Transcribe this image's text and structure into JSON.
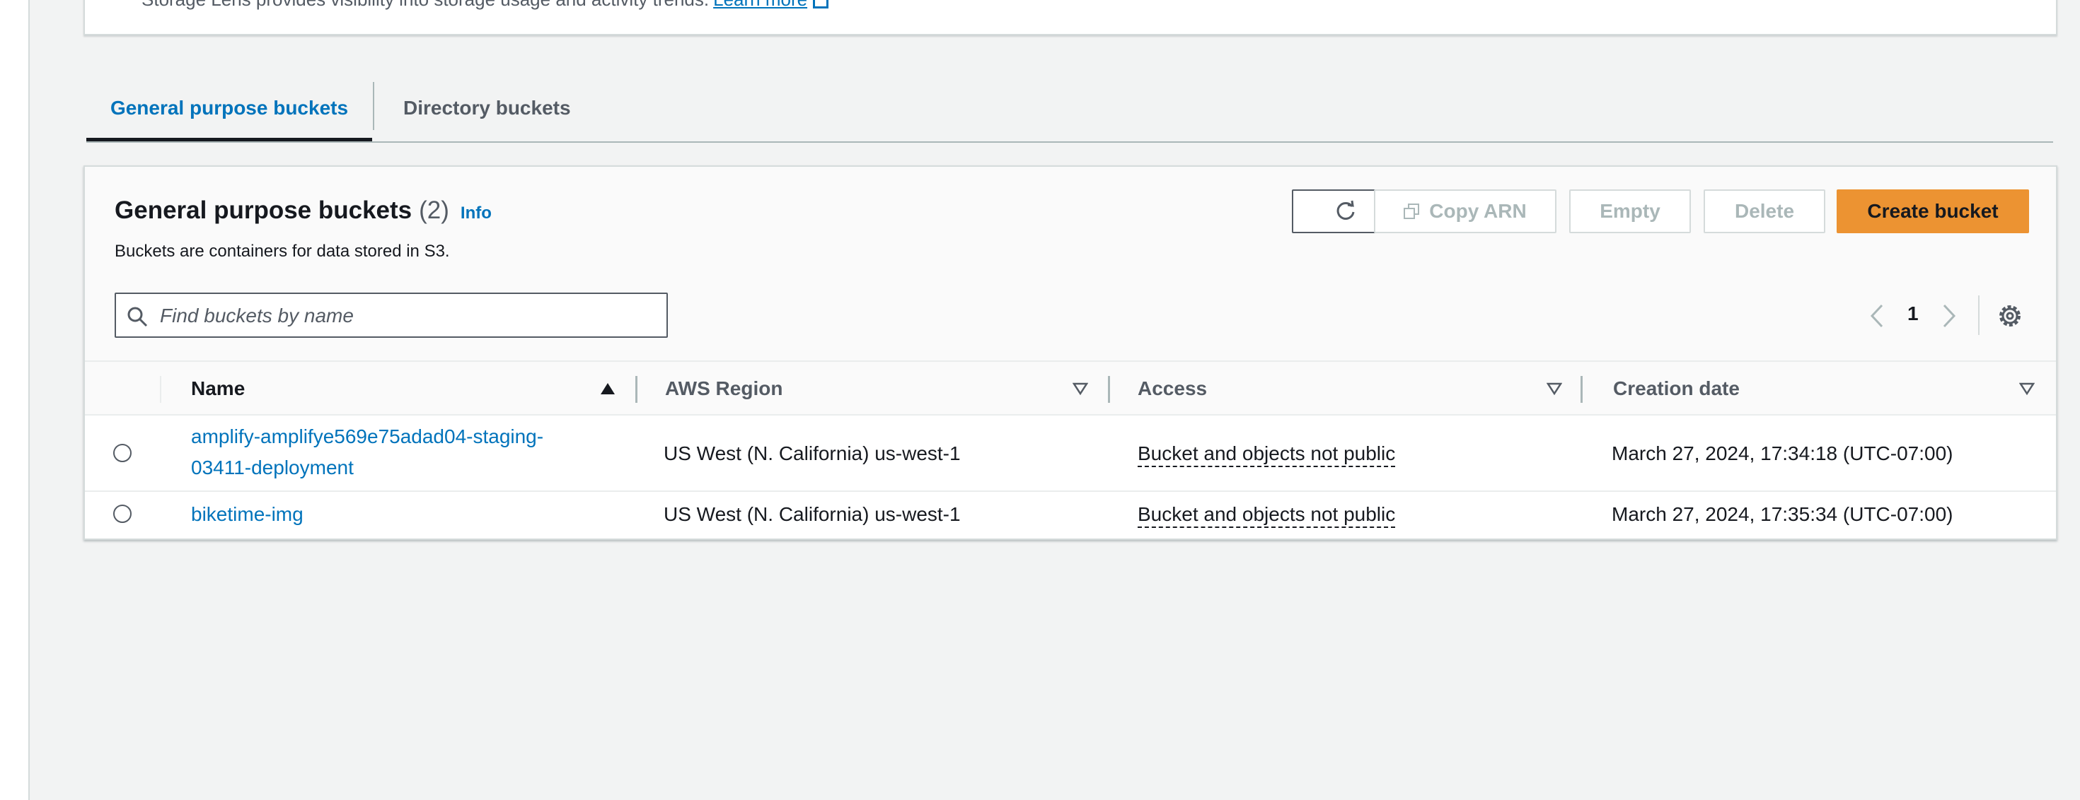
{
  "top_panel": {
    "text": "Storage Lens provides visibility into storage usage and activity trends.",
    "link": "Learn more"
  },
  "tabs": [
    {
      "label": "General purpose buckets",
      "active": true
    },
    {
      "label": "Directory buckets",
      "active": false
    }
  ],
  "container": {
    "title": "General purpose buckets",
    "count": "(2)",
    "info": "Info",
    "description": "Buckets are containers for data stored in S3."
  },
  "actions": {
    "refresh_icon": "refresh-icon",
    "copy_arn": "Copy ARN",
    "empty": "Empty",
    "delete": "Delete",
    "create": "Create bucket"
  },
  "search": {
    "placeholder": "Find buckets by name",
    "value": ""
  },
  "pagination": {
    "current_page": "1"
  },
  "table": {
    "columns": [
      "Name",
      "AWS Region",
      "Access",
      "Creation date"
    ],
    "rows": [
      {
        "name": "amplify-amplifye569e75adad04-staging-03411-deployment",
        "region": "US West (N. California) us-west-1",
        "access": "Bucket and objects not public",
        "created": "March 27, 2024, 17:34:18 (UTC-07:00)"
      },
      {
        "name": "biketime-img",
        "region": "US West (N. California) us-west-1",
        "access": "Bucket and objects not public",
        "created": "March 27, 2024, 17:35:34 (UTC-07:00)"
      }
    ]
  },
  "colors": {
    "link": "#0073bb",
    "primary_button": "#ec9332",
    "text": "#16191f",
    "secondary_text": "#545b64",
    "disabled": "#aab7b8"
  }
}
